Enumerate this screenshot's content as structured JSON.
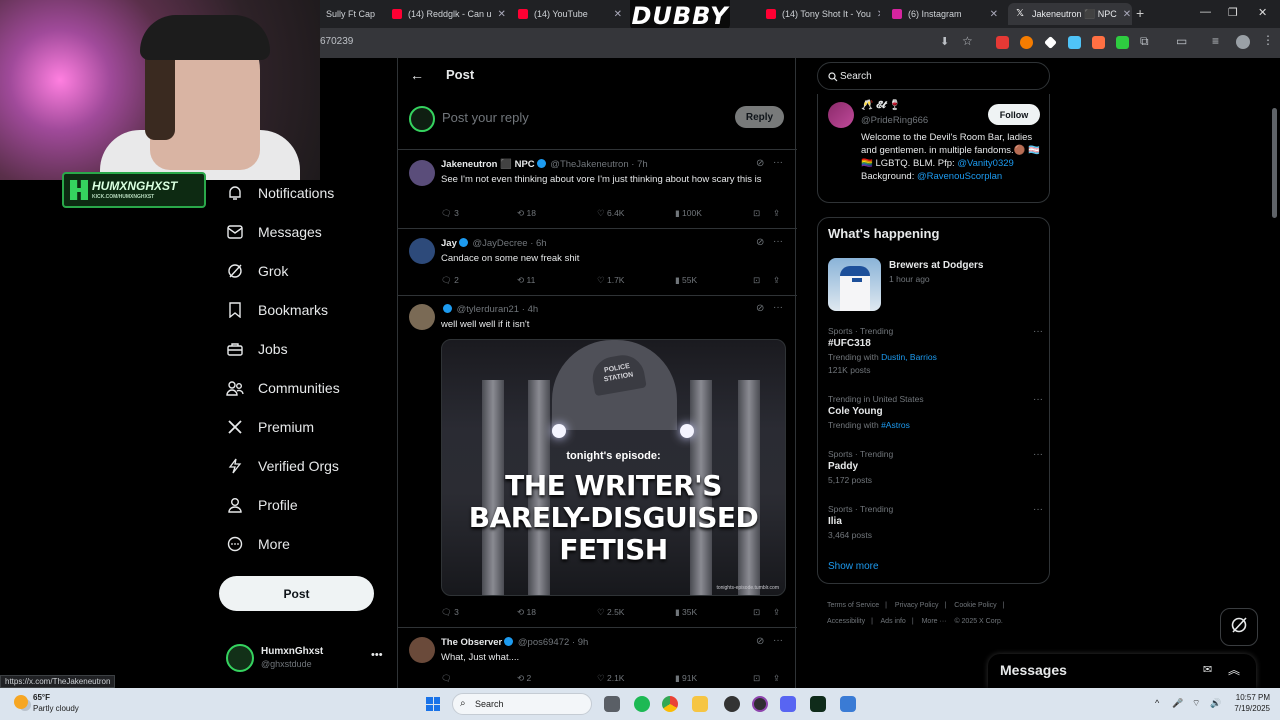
{
  "browser": {
    "tabs": [
      {
        "title": "Sully Ft Cap",
        "color": "#e84c3d"
      },
      {
        "title": "(14) Reddglk - Can u",
        "color": "#ff0033"
      },
      {
        "title": "(14) YouTube",
        "color": "#ff0033"
      },
      {
        "title": "(14) Tony Shot It - You",
        "color": "#ff0033"
      },
      {
        "title": "(6) Instagram",
        "color": "#d6249f"
      },
      {
        "title": "Jakeneutron ⬛ NPC",
        "color": "#ffffff"
      }
    ],
    "url": "670239",
    "status_url": "https://x.com/TheJakeneutron"
  },
  "overlay": {
    "brand_badge": "DUBBY",
    "streamer_logo": "HUMXNGHXST",
    "streamer_sub": "KICK.COM/HUMXNGHXST"
  },
  "nav": {
    "items": [
      {
        "label": "Notifications",
        "icon": "bell-icon"
      },
      {
        "label": "Messages",
        "icon": "envelope-icon"
      },
      {
        "label": "Grok",
        "icon": "grok-icon"
      },
      {
        "label": "Bookmarks",
        "icon": "bookmark-icon"
      },
      {
        "label": "Jobs",
        "icon": "briefcase-icon"
      },
      {
        "label": "Communities",
        "icon": "people-icon"
      },
      {
        "label": "Premium",
        "icon": "x-logo-icon"
      },
      {
        "label": "Verified Orgs",
        "icon": "lightning-icon"
      },
      {
        "label": "Profile",
        "icon": "person-icon"
      },
      {
        "label": "More",
        "icon": "more-circle-icon"
      }
    ],
    "post_label": "Post",
    "account": {
      "name": "HumxnGhxst",
      "handle": "@ghxstdude"
    }
  },
  "main": {
    "title": "Post",
    "reply_placeholder": "Post your reply",
    "reply_button": "Reply",
    "tweets": [
      {
        "name": "Jakeneutron ⬛ NPC",
        "handle": "@TheJakeneutron",
        "time": "7h",
        "text": "See I'm not even thinking about vore I'm just thinking about how scary this is",
        "replies": "3",
        "reposts": "18",
        "likes": "6.4K",
        "views": "100K",
        "avatar_color": "#5a4d7a"
      },
      {
        "name": "Jay",
        "handle": "@JayDecree",
        "time": "6h",
        "text": "Candace on some new freak shit",
        "replies": "2",
        "reposts": "11",
        "likes": "1.7K",
        "views": "55K",
        "avatar_color": "#2d4a7a"
      },
      {
        "name": "",
        "handle": "@tylerduran21",
        "time": "4h",
        "text": "well well well if it isn't",
        "replies": "3",
        "reposts": "18",
        "likes": "2.5K",
        "views": "35K",
        "avatar_color": "#7a6a55",
        "media": {
          "sign": "POLICE STATION",
          "episode": "tonight's episode:",
          "caption_lines": [
            "THE WRITER'S",
            "BARELY-DISGUISED",
            "FETISH"
          ],
          "watermark": "tonights-episode.tumblr.com"
        }
      },
      {
        "name": "The Observer",
        "handle": "@pos69472",
        "time": "9h",
        "text": "What, Just what....",
        "replies": "",
        "reposts": "2",
        "likes": "2.1K",
        "views": "91K",
        "avatar_color": "#6a4a3a"
      }
    ]
  },
  "sidebar": {
    "search_placeholder": "Search",
    "profile": {
      "name": "🥂 𝓔𝓽 🍷",
      "handle": "@PrideRing666",
      "follow": "Follow",
      "bio_text": "Welcome to the Devil's Room Bar, ladies and gentlemen. in multiple fandoms.🟤 🏳️‍⚧️🏳️‍🌈 LGBTQ. BLM. Pfp: ",
      "bio_link1": "@Vanity0329",
      "bio_mid": " Background: ",
      "bio_link2": "@RavenouScorplan"
    },
    "happening": {
      "title": "What's happening",
      "event": {
        "title": "Brewers at Dodgers",
        "sub": "1 hour ago"
      },
      "trends": [
        {
          "category": "Sports · Trending",
          "title": "#UFC318",
          "meta_prefix": "Trending with ",
          "meta_links": "Dustin, Barrios",
          "posts": "121K posts"
        },
        {
          "category": "Trending in United States",
          "title": "Cole Young",
          "meta_prefix": "Trending with ",
          "meta_links": "#Astros",
          "posts": ""
        },
        {
          "category": "Sports · Trending",
          "title": "Paddy",
          "meta_prefix": "",
          "meta_links": "",
          "posts": "5,172 posts"
        },
        {
          "category": "Sports · Trending",
          "title": "Ilia",
          "meta_prefix": "",
          "meta_links": "",
          "posts": "3,464 posts"
        }
      ],
      "show_more": "Show more"
    },
    "footer": [
      "Terms of Service",
      "|",
      "Privacy Policy",
      "|",
      "Cookie Policy",
      "|",
      "Accessibility",
      "|",
      "Ads info",
      "|",
      "More ···",
      "© 2025 X Corp."
    ]
  },
  "messages_dock": {
    "title": "Messages"
  },
  "taskbar": {
    "weather_temp": "65°F",
    "weather_desc": "Partly cloudy",
    "search": "Search",
    "time": "10:57 PM",
    "date": "7/19/2025"
  }
}
